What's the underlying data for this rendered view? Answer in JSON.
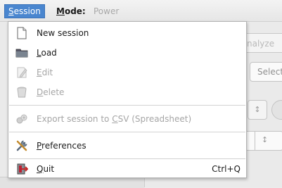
{
  "menubar": {
    "session": {
      "pre": "",
      "mn": "S",
      "post": "ession"
    },
    "mode": {
      "pre": "",
      "mn": "M",
      "post": "ode:"
    },
    "power": "Power"
  },
  "background": {
    "tab_label": "nalyze",
    "select_label": "Select",
    "spin_glyph": "↕"
  },
  "session_menu": {
    "items": [
      {
        "pre": "New session",
        "mn": "",
        "post": "",
        "shortcut": "",
        "icon": "new-document-icon",
        "enabled": true
      },
      {
        "pre": "",
        "mn": "L",
        "post": "oad",
        "shortcut": "",
        "icon": "folder-icon",
        "enabled": true
      },
      {
        "pre": "",
        "mn": "E",
        "post": "dit",
        "shortcut": "",
        "icon": "edit-icon",
        "enabled": false
      },
      {
        "pre": "",
        "mn": "D",
        "post": "elete",
        "shortcut": "",
        "icon": "trash-icon",
        "enabled": false
      },
      {
        "pre": "Export session to ",
        "mn": "C",
        "post": "SV (Spreadsheet)",
        "shortcut": "",
        "icon": "export-icon",
        "enabled": false
      },
      {
        "pre": "",
        "mn": "P",
        "post": "references",
        "shortcut": "",
        "icon": "preferences-icon",
        "enabled": true
      },
      {
        "pre": "",
        "mn": "Q",
        "post": "uit",
        "shortcut": "Ctrl+Q",
        "icon": "quit-icon",
        "enabled": true
      }
    ]
  }
}
